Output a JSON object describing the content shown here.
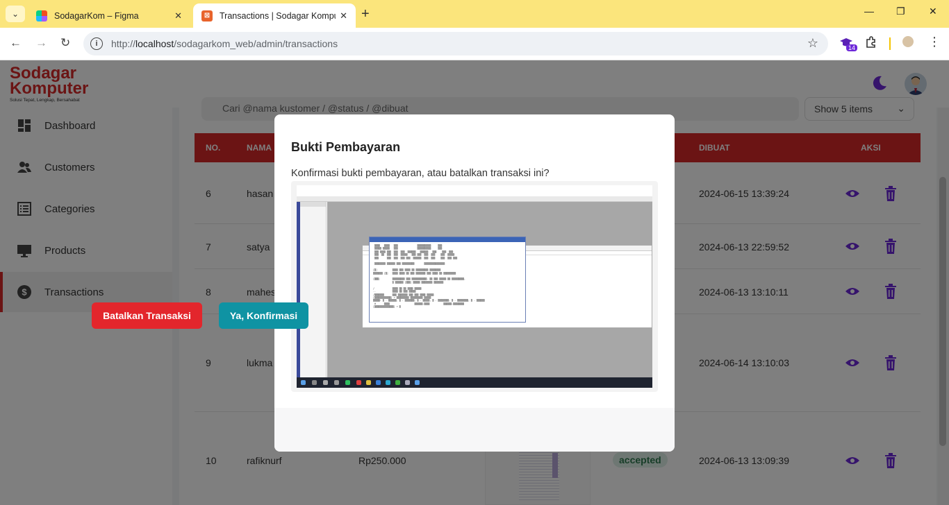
{
  "browser": {
    "tabs": [
      {
        "title": "SodagarKom – Figma",
        "active": false
      },
      {
        "title": "Transactions | Sodagar Komputer",
        "active": true
      }
    ],
    "url_scheme": "http://",
    "url_host": "localhost",
    "url_path": "/sodagarkom_web/admin/transactions",
    "extension_badge": "14"
  },
  "app": {
    "logo_line1": "Sodagar",
    "logo_line2": "Komputer",
    "logo_tagline": "Solusi Tepat, Lengkap, Bersahabat",
    "brand_color": "#d62828",
    "accent_color": "#6d28d9"
  },
  "sidebar": {
    "items": [
      {
        "label": "Dashboard",
        "icon": "dashboard-icon"
      },
      {
        "label": "Customers",
        "icon": "users-icon"
      },
      {
        "label": "Categories",
        "icon": "list-icon"
      },
      {
        "label": "Products",
        "icon": "monitor-icon"
      },
      {
        "label": "Transactions",
        "icon": "dollar-icon",
        "active": true
      }
    ]
  },
  "toolbar": {
    "search_placeholder": "Cari @nama kustomer / @status / @dibuat",
    "show_select": "Show 5 items"
  },
  "table": {
    "headers": {
      "no": "NO.",
      "nama": "NAMA",
      "dibuat": "DIBUAT",
      "aksi": "AKSI"
    },
    "rows": [
      {
        "no": "6",
        "nama": "hasan",
        "dibuat": "2024-06-15 13:39:24"
      },
      {
        "no": "7",
        "nama": "satya",
        "dibuat": "2024-06-13 22:59:52"
      },
      {
        "no": "8",
        "nama": "mahes",
        "dibuat": "2024-06-13 13:10:11"
      },
      {
        "no": "9",
        "nama": "lukma",
        "dibuat": "2024-06-14 13:10:03"
      },
      {
        "no": "10",
        "nama": "rafiknurf",
        "total": "Rp250.000",
        "status": "accepted",
        "dibuat": "2024-06-13 13:09:39"
      }
    ]
  },
  "modal": {
    "title": "Bukti Pembayaran",
    "text": "Konfirmasi bukti pembayaran, atau batalkan transaksi ini?",
    "cancel_label": "Batalkan Transaksi",
    "confirm_label": "Ya, Konfirmasi"
  }
}
